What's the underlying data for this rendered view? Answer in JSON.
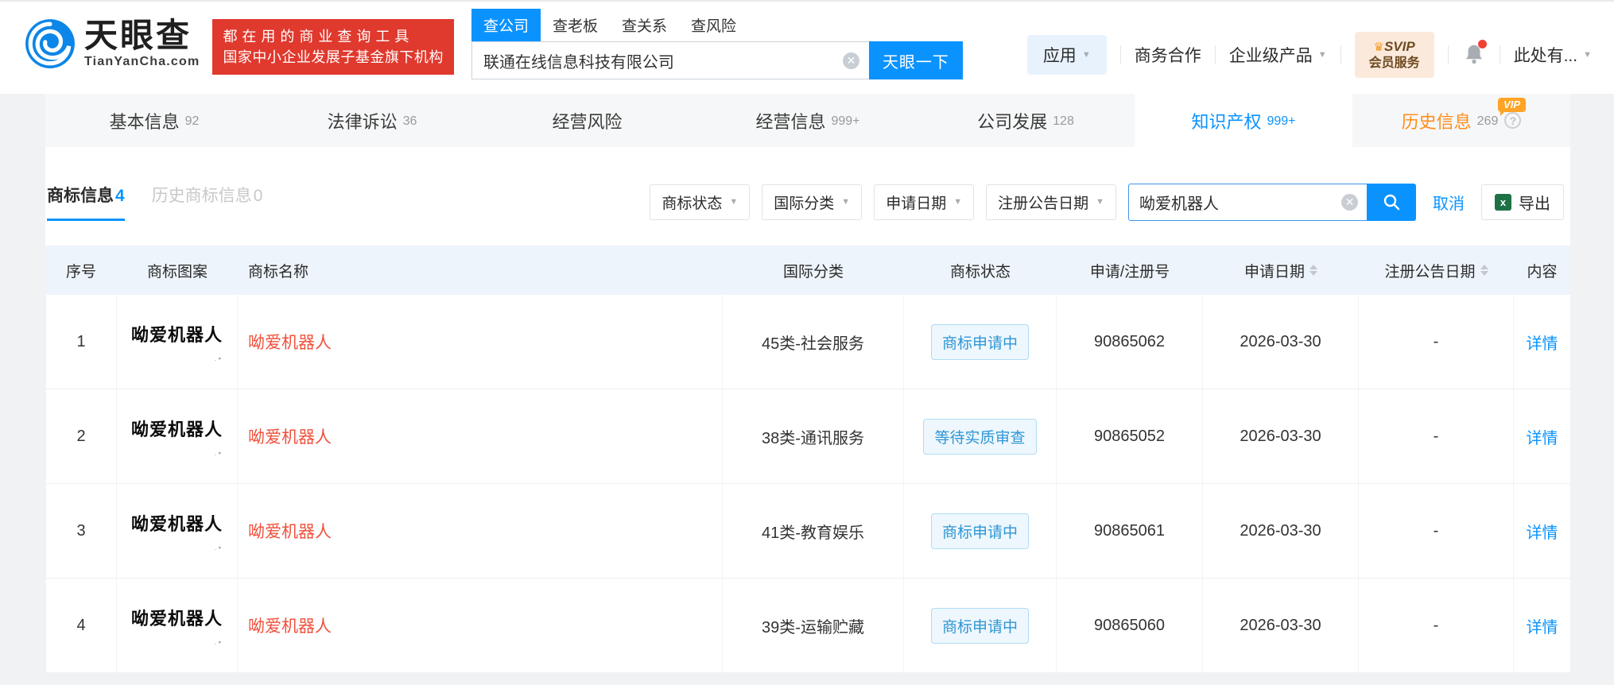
{
  "colors": {
    "accent_blue": "#0a93ff",
    "promo_red": "#e0392e",
    "history_orange": "#ff8d1a",
    "status_blue": "#2e96d5",
    "name_red": "#f0503c",
    "excel_green": "#1e7145",
    "table_header_bg": "#edf4fb"
  },
  "header": {
    "logo_title": "天眼查",
    "logo_domain": "TianYanCha.com",
    "promo_line1": "都在用的商业查询工具",
    "promo_line2": "国家中小企业发展子基金旗下机构",
    "search_tabs": [
      {
        "label": "查公司"
      },
      {
        "label": "查老板"
      },
      {
        "label": "查关系"
      },
      {
        "label": "查风险"
      }
    ],
    "search_value": "联通在线信息科技有限公司",
    "search_button": "天眼一下",
    "menu": {
      "apps": "应用",
      "cooperation": "商务合作",
      "enterprise": "企业级产品",
      "svip_line1": "SVIP",
      "svip_line2": "会员服务",
      "user": "此处有..."
    }
  },
  "nav_tabs": [
    {
      "label": "基本信息",
      "count": "92"
    },
    {
      "label": "法律诉讼",
      "count": "36"
    },
    {
      "label": "经营风险",
      "count": ""
    },
    {
      "label": "经营信息",
      "count": "999+"
    },
    {
      "label": "公司发展",
      "count": "128"
    },
    {
      "label": "知识产权",
      "count": "999+"
    },
    {
      "label": "历史信息",
      "count": "269",
      "vip_tag": "VIP"
    }
  ],
  "section": {
    "tabs": [
      {
        "label": "商标信息",
        "count": "4"
      },
      {
        "label": "历史商标信息",
        "count": "0"
      }
    ],
    "filters": [
      "商标状态",
      "国际分类",
      "申请日期",
      "注册公告日期"
    ],
    "keyword": "呦爱机器人",
    "cancel": "取消",
    "export": "导出"
  },
  "table": {
    "headers": [
      "序号",
      "商标图案",
      "商标名称",
      "国际分类",
      "商标状态",
      "申请/注册号",
      "申请日期",
      "注册公告日期",
      "内容"
    ],
    "rows": [
      {
        "index": "1",
        "image_text": "呦爱机器人",
        "name": "呦爱机器人",
        "category": "45类-社会服务",
        "status": "商标申请中",
        "reg_no": "90865062",
        "apply_date": "2026-03-30",
        "announce_date": "-",
        "detail": "详情"
      },
      {
        "index": "2",
        "image_text": "呦爱机器人",
        "name": "呦爱机器人",
        "category": "38类-通讯服务",
        "status": "等待实质审查",
        "reg_no": "90865052",
        "apply_date": "2026-03-30",
        "announce_date": "-",
        "detail": "详情"
      },
      {
        "index": "3",
        "image_text": "呦爱机器人",
        "name": "呦爱机器人",
        "category": "41类-教育娱乐",
        "status": "商标申请中",
        "reg_no": "90865061",
        "apply_date": "2026-03-30",
        "announce_date": "-",
        "detail": "详情"
      },
      {
        "index": "4",
        "image_text": "呦爱机器人",
        "name": "呦爱机器人",
        "category": "39类-运输贮藏",
        "status": "商标申请中",
        "reg_no": "90865060",
        "apply_date": "2026-03-30",
        "announce_date": "-",
        "detail": "详情"
      }
    ]
  }
}
